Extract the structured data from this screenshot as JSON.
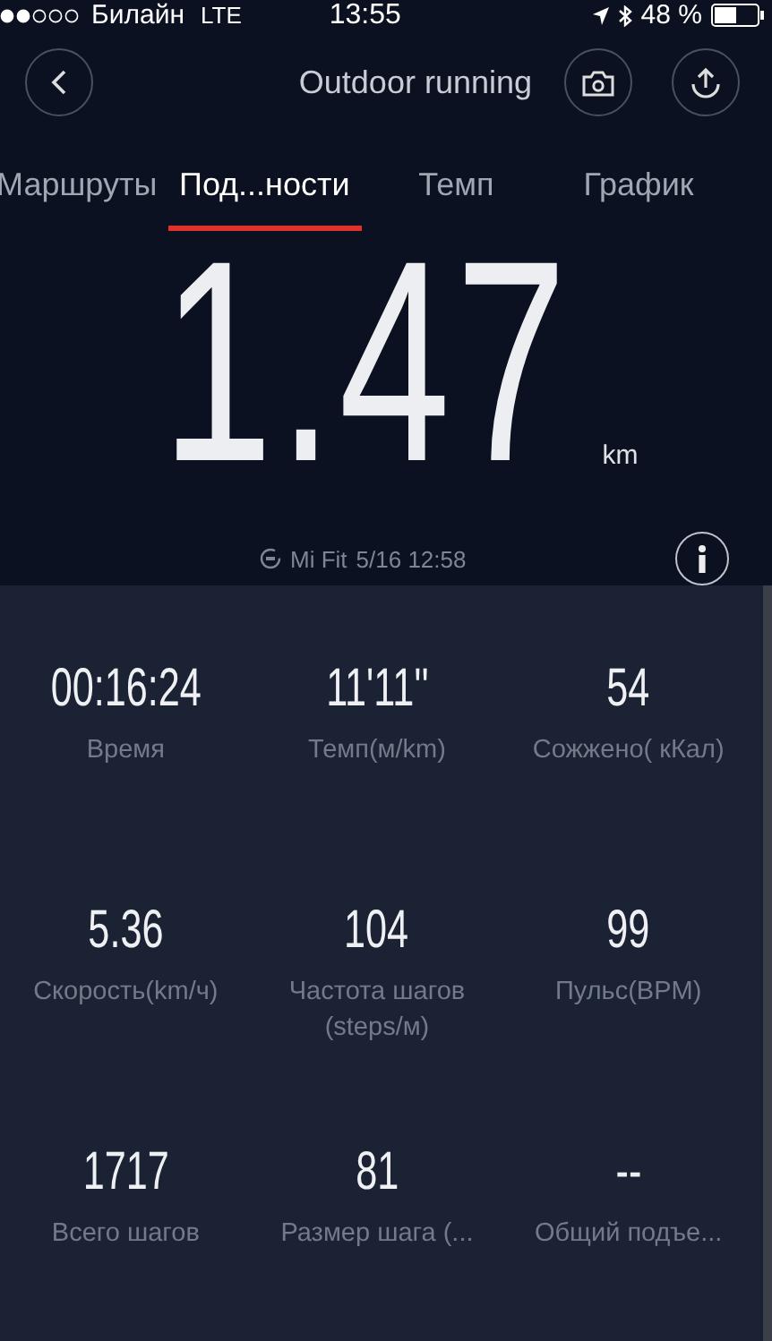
{
  "status_bar": {
    "carrier": "Билайн",
    "network": "LTE",
    "time": "13:55",
    "battery": "48 %"
  },
  "nav": {
    "title": "Outdoor running"
  },
  "tabs": [
    {
      "label": "Маршруты",
      "selected": false
    },
    {
      "label": "Под...ности",
      "selected": true
    },
    {
      "label": "Темп",
      "selected": false
    },
    {
      "label": "График",
      "selected": false
    }
  ],
  "distance": {
    "value": "1.47",
    "unit": "km"
  },
  "source": {
    "app": "Mi Fit",
    "date": "5/16 12:58"
  },
  "stats": [
    {
      "value": "00:16:24",
      "label": "Время"
    },
    {
      "value": "11'11''",
      "label": "Темп(м/km)"
    },
    {
      "value": "54",
      "label": "Сожжено( кКал)"
    },
    {
      "value": "5.36",
      "label": "Скорость(km/ч)"
    },
    {
      "value": "104",
      "label": "Частота шагов (steps/м)"
    },
    {
      "value": "99",
      "label": "Пульс(BPM)"
    },
    {
      "value": "1717",
      "label": "Всего шагов"
    },
    {
      "value": "81",
      "label": "Размер шага (..."
    },
    {
      "value": "--",
      "label": "Общий подъе..."
    }
  ]
}
